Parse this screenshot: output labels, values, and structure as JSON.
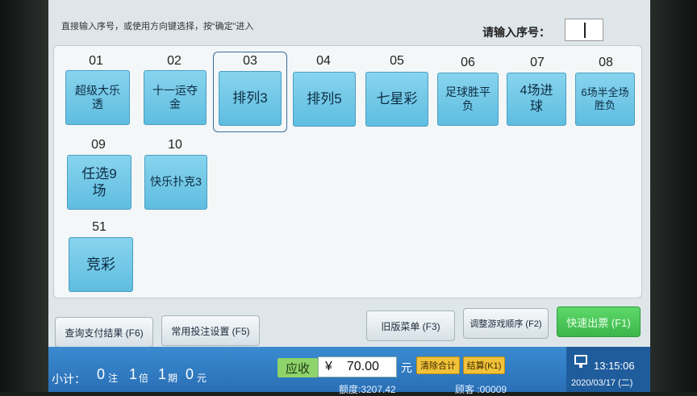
{
  "hint": "直接输入序号，或使用方向键选择，按“确定”进入",
  "seq_label": "请输入序号：",
  "games": [
    {
      "num": "01",
      "name": "超级大乐透"
    },
    {
      "num": "02",
      "name": "十一运夺金"
    },
    {
      "num": "03",
      "name": "排列3",
      "selected": true
    },
    {
      "num": "04",
      "name": "排列5"
    },
    {
      "num": "05",
      "name": "七星彩"
    },
    {
      "num": "06",
      "name": "足球胜平负"
    },
    {
      "num": "07",
      "name": "4场进球"
    },
    {
      "num": "08",
      "name": "6场半全场胜负"
    },
    {
      "num": "09",
      "name": "任选9场"
    },
    {
      "num": "10",
      "name": "快乐扑克3"
    },
    {
      "num": "51",
      "name": "竞彩"
    }
  ],
  "buttons": {
    "query_payment": "查询支付结果 (F6)",
    "common_settings": "常用投注设置 (F5)",
    "old_menu": "旧版菜单 (F3)",
    "adjust_order": "调整游戏顺序 (F2)",
    "quick_ticket": "快速出票 (F1)"
  },
  "status": {
    "subtotal_label": "小计：",
    "zhu_count": "0",
    "zhu_unit": "注",
    "bei_count": "1",
    "bei_unit": "倍",
    "qi_count": "1",
    "qi_unit": "期",
    "yuan_count": "0",
    "yuan_unit": "元",
    "receivable_label": "应收",
    "currency": "¥",
    "amount": "70.00",
    "amount_unit": "元",
    "clear_total": "清除合计",
    "settle": "结算(K1)",
    "balance": "额度:3207.42",
    "customer": "顾客 :00009",
    "time": "13:15:06",
    "date": "2020/03/17 (二)"
  },
  "colors": {
    "tile": "#6cc6e6",
    "quick_ticket": "#3cb64a",
    "status_bar": "#2a6fb6"
  }
}
